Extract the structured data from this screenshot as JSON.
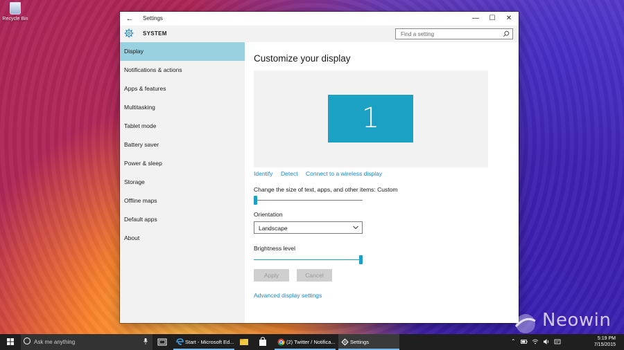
{
  "desktop": {
    "recycle_bin_label": "Recycle Bin",
    "watermark": "Neowin"
  },
  "window": {
    "title": "Settings",
    "section_title": "SYSTEM",
    "search_placeholder": "Find a setting"
  },
  "sidebar": {
    "items": [
      {
        "label": "Display",
        "active": true
      },
      {
        "label": "Notifications & actions"
      },
      {
        "label": "Apps & features"
      },
      {
        "label": "Multitasking"
      },
      {
        "label": "Tablet mode"
      },
      {
        "label": "Battery saver"
      },
      {
        "label": "Power & sleep"
      },
      {
        "label": "Storage"
      },
      {
        "label": "Offline maps"
      },
      {
        "label": "Default apps"
      },
      {
        "label": "About"
      }
    ]
  },
  "content": {
    "title": "Customize your display",
    "monitor_number": "1",
    "links": {
      "identify": "Identify",
      "detect": "Detect",
      "wireless": "Connect to a wireless display"
    },
    "scale_label": "Change the size of text, apps, and other items: Custom",
    "scale_level": 0.0,
    "orientation_label": "Orientation",
    "orientation_value": "Landscape",
    "brightness_label": "Brightness level",
    "brightness_level": 1.0,
    "apply_label": "Apply",
    "cancel_label": "Cancel",
    "advanced_link": "Advanced display settings"
  },
  "taskbar": {
    "search_placeholder": "Ask me anything",
    "apps": [
      {
        "label": "Start - Microsoft Ed..."
      },
      {
        "label": "(2) Twitter / Notifica..."
      },
      {
        "label": "Settings",
        "active": true
      }
    ],
    "time": "5:19 PM",
    "date": "7/15/2015"
  },
  "colors": {
    "accent": "#1ba1c4",
    "selected_nav": "#99d1e0",
    "link": "#1a86c8",
    "taskbar": "#1f1f1f"
  }
}
